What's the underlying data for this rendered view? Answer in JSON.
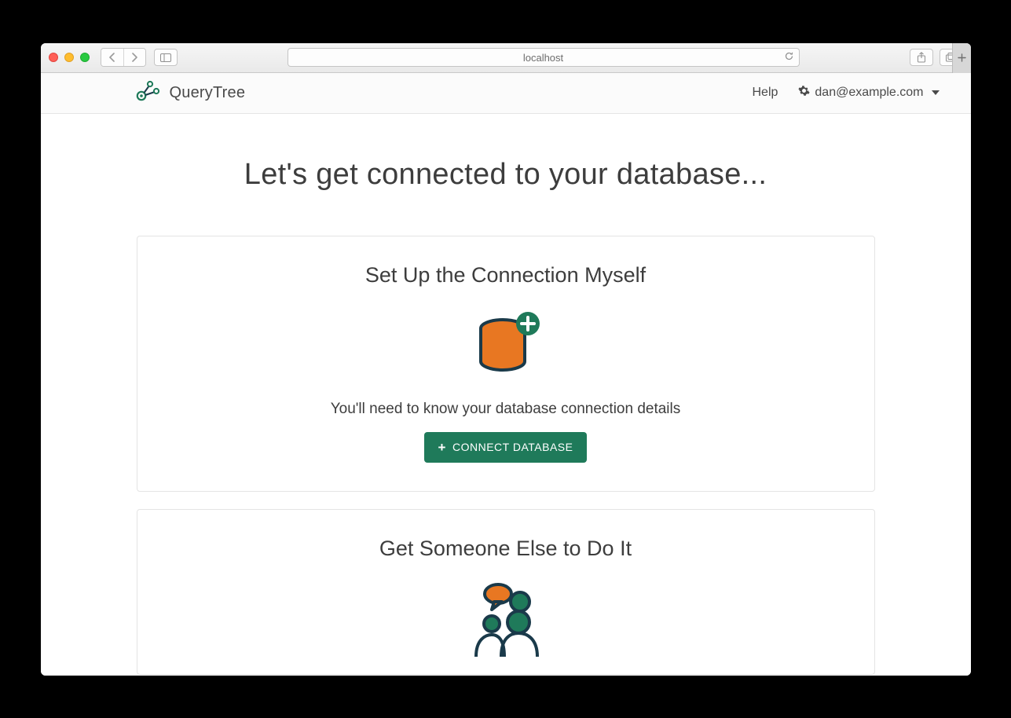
{
  "browser": {
    "address": "localhost"
  },
  "navbar": {
    "brand": "QueryTree",
    "help_label": "Help",
    "user_email": "dan@example.com"
  },
  "page": {
    "title": "Let's get connected to your database..."
  },
  "card1": {
    "title": "Set Up the Connection Myself",
    "description": "You'll need to know your database connection details",
    "button_label": "CONNECT DATABASE"
  },
  "card2": {
    "title": "Get Someone Else to Do It"
  },
  "colors": {
    "accent_green": "#1f7a5a",
    "accent_orange": "#e87722",
    "outline": "#1a3a4a"
  }
}
